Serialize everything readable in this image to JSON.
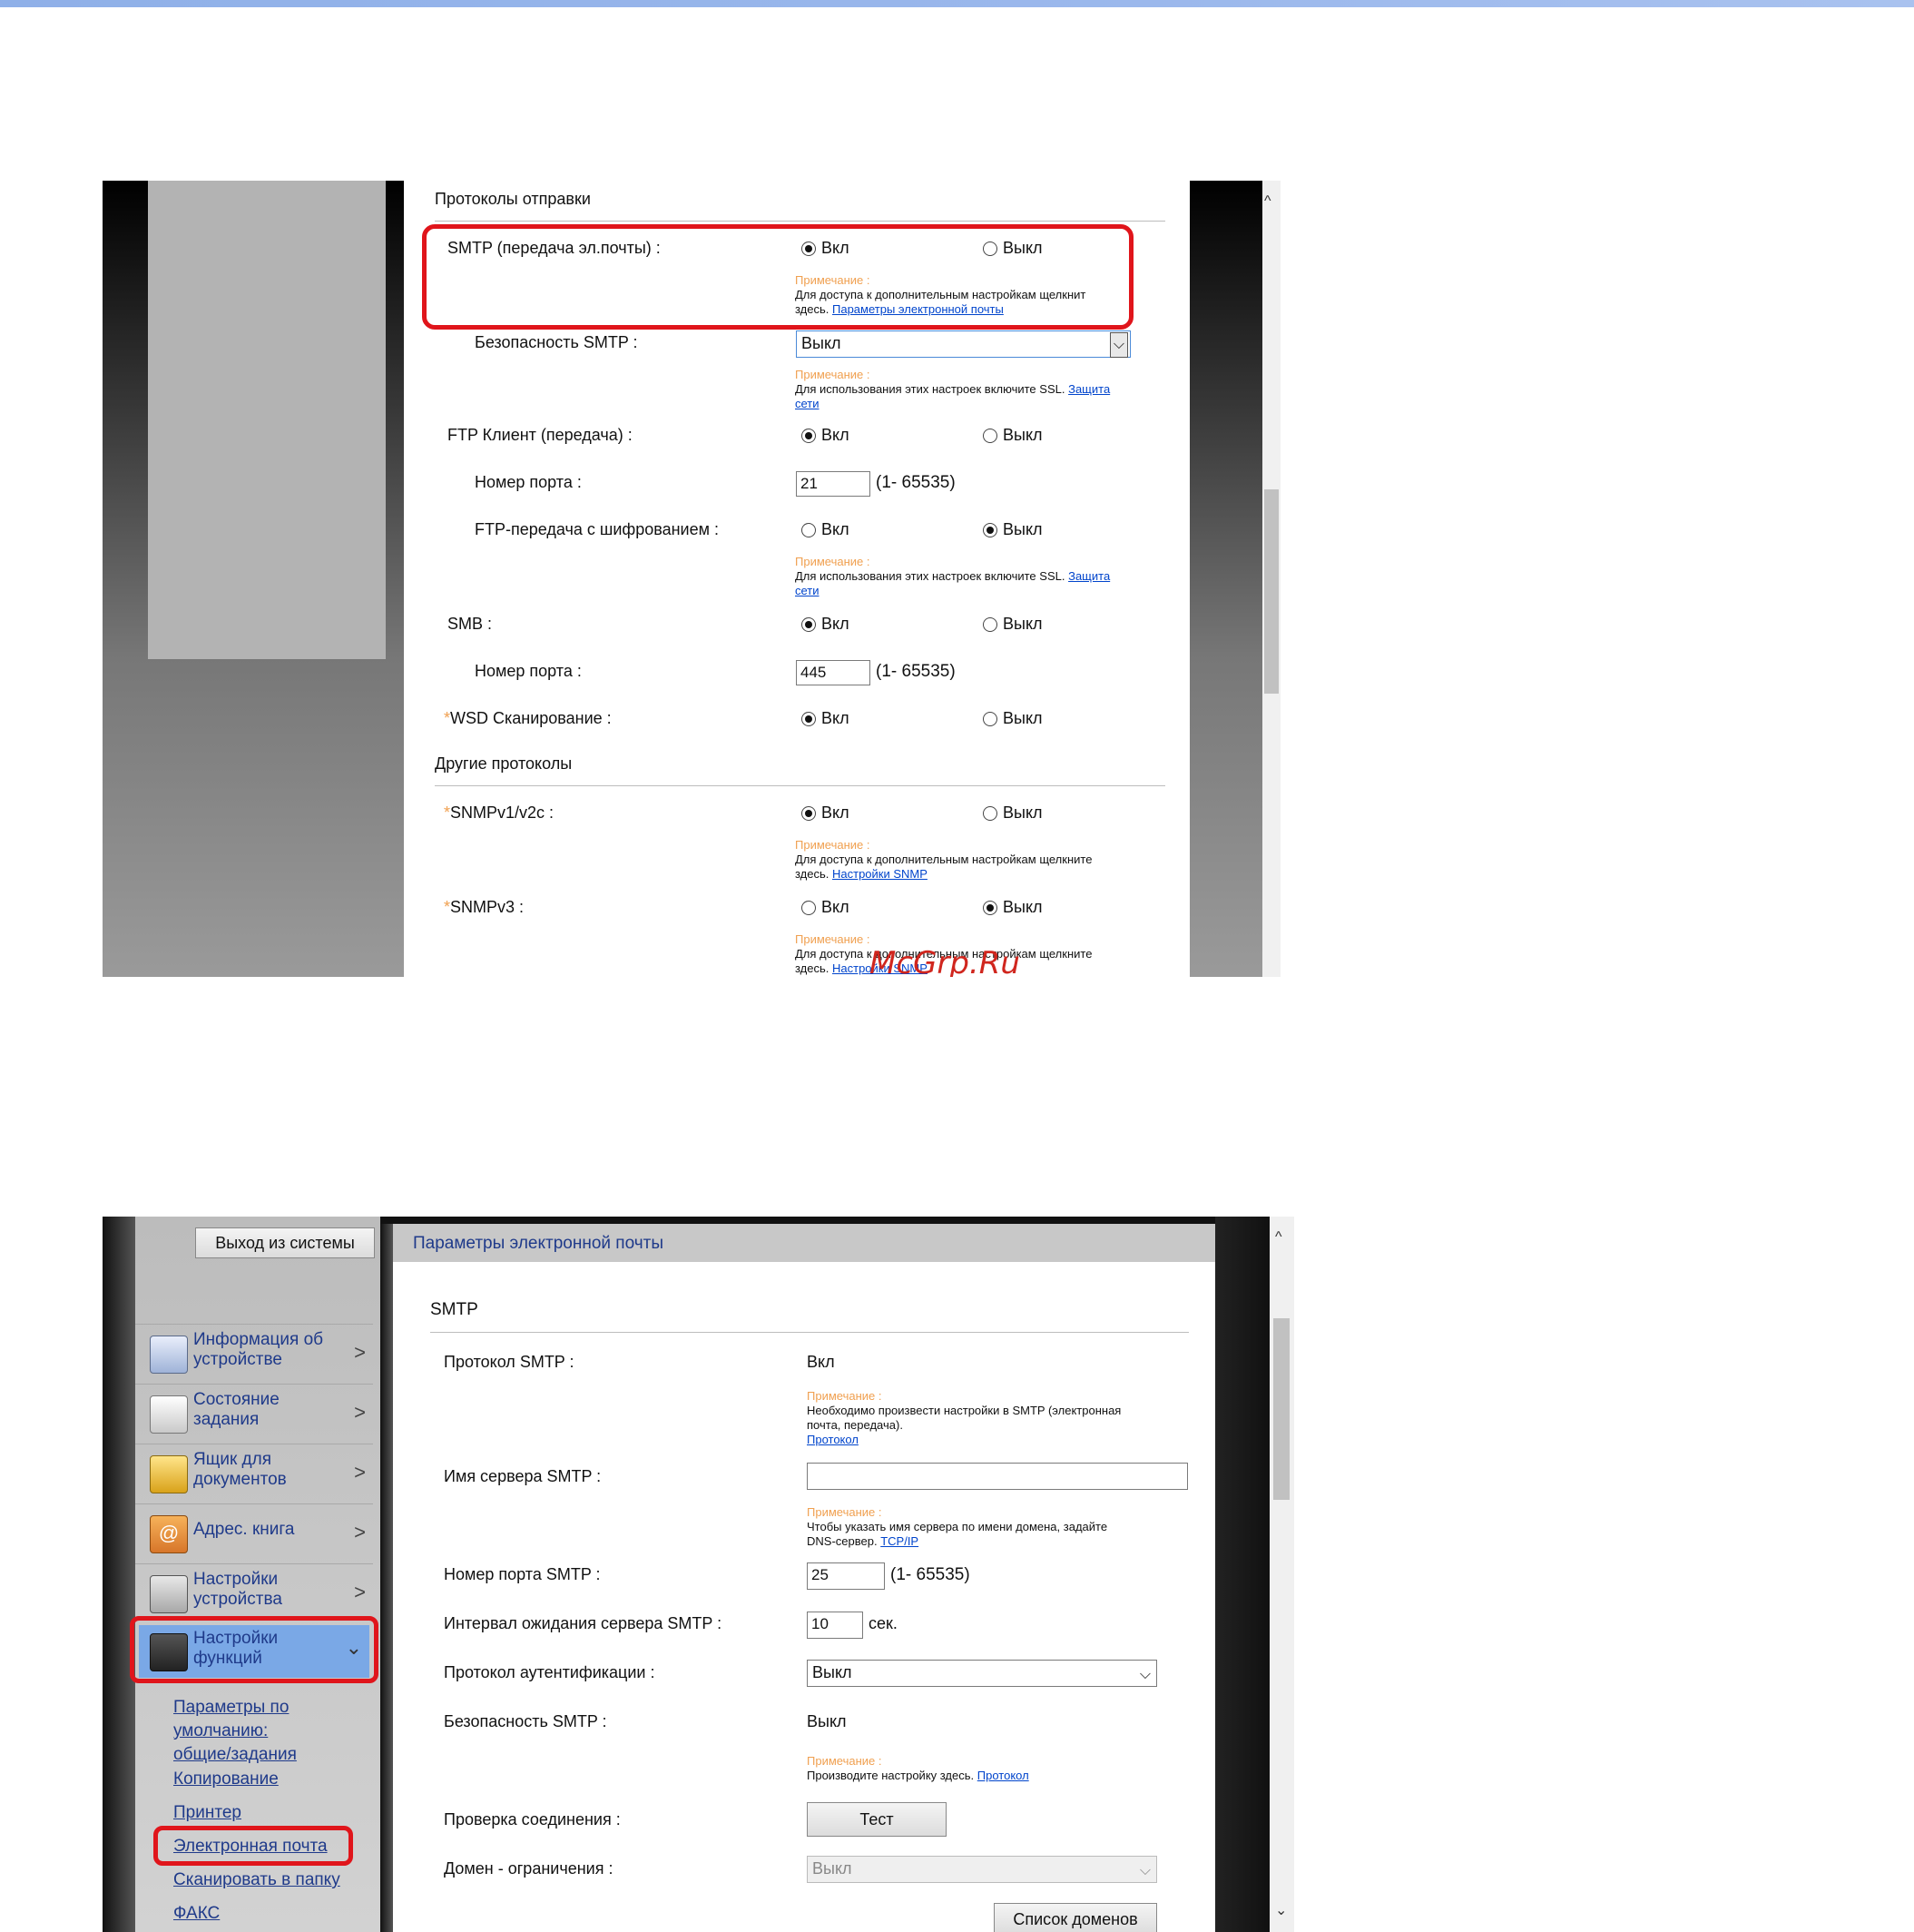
{
  "colors": {
    "accent_red": "#e0151b",
    "note_orange": "#f0a050",
    "link_blue": "#0044cc",
    "menu_blue": "#1f3a8a",
    "selected_menu": "#7aa8e6"
  },
  "top": {
    "section_send": "Протоколы отправки",
    "smtp_label": "SMTP (передача эл.почты) :",
    "on": "Вкл",
    "off": "Выкл",
    "note": "Примечание :",
    "smtp_note": "Для доступа к дополнительным настройкам щелкнит",
    "smtp_note_here": "здесь.",
    "smtp_note_link": "Параметры электронной почты",
    "smtp_security_label": "Безопасность SMTP :",
    "smtp_security_value": "Выкл",
    "ssl_note": "Для использования этих настроек включите SSL.",
    "ssl_link1": "Защита",
    "ssl_link2": "сети",
    "ftp_label": "FTP Клиент (передача) :",
    "port_label": "Номер порта :",
    "ftp_port": "21",
    "port_range": "(1- 65535)",
    "ftp_enc_label": "FTP-передача с шифрованием :",
    "smb_label": "SMB :",
    "smb_port": "445",
    "wsd_star": "*",
    "wsd_label": "WSD Сканирование :",
    "section_other": "Другие протоколы",
    "snmp12_label": "SNMPv1/v2c :",
    "snmp_note": "Для доступа к дополнительным настройкам щелкните",
    "snmp_note_here": "здесь.",
    "snmp_link": "Настройки SNMP",
    "snmp3_label": "SNMPv3 :",
    "watermark": "McGrp.Ru"
  },
  "bottom": {
    "logout": "Выход из системы",
    "page_title": "Параметры электронной почты",
    "menu": [
      {
        "label1": "Информация об",
        "label2": "устройстве"
      },
      {
        "label1": "Состояние",
        "label2": "задания"
      },
      {
        "label1": "Ящик для",
        "label2": "документов"
      },
      {
        "label1": "Адрес. книга",
        "label2": ""
      },
      {
        "label1": "Настройки",
        "label2": "устройства"
      },
      {
        "label1": "Настройки",
        "label2": "функций"
      }
    ],
    "sub": {
      "defaults1": "Параметры по",
      "defaults2": "умолчанию:",
      "defaults3": "общие/задания",
      "copy": "Копирование",
      "printer": "Принтер",
      "email": "Электронная почта",
      "scan_folder": "Сканировать в папку",
      "fax": "ФАКС"
    },
    "section": "SMTP",
    "proto_label": "Протокол SMTP :",
    "proto_value": "Вкл",
    "note": "Примечание :",
    "proto_note1": "Необходимо произвести настройки в SMTP (электронная",
    "proto_note2": "почта, передача).",
    "proto_link": "Протокол",
    "server_label": "Имя сервера SMTP :",
    "server_value": "",
    "server_note1": "Чтобы указать имя сервера по имени домена, задайте",
    "server_note2": "DNS-сервер.",
    "server_link": "TCP/IP",
    "port_label": "Номер порта SMTP :",
    "port_value": "25",
    "port_range": "(1- 65535)",
    "timeout_label": "Интервал ожидания сервера SMTP :",
    "timeout_value": "10",
    "timeout_unit": "сек.",
    "auth_label": "Протокол аутентификации :",
    "auth_value": "Выкл",
    "security_label": "Безопасность SMTP :",
    "security_value": "Выкл",
    "security_note": "Производите настройку здесь.",
    "security_link": "Протокол",
    "conn_label": "Проверка соединения :",
    "test_button": "Тест",
    "domain_label": "Домен - ограничения :",
    "domain_value": "Выкл",
    "domain_list_button": "Список доменов"
  }
}
